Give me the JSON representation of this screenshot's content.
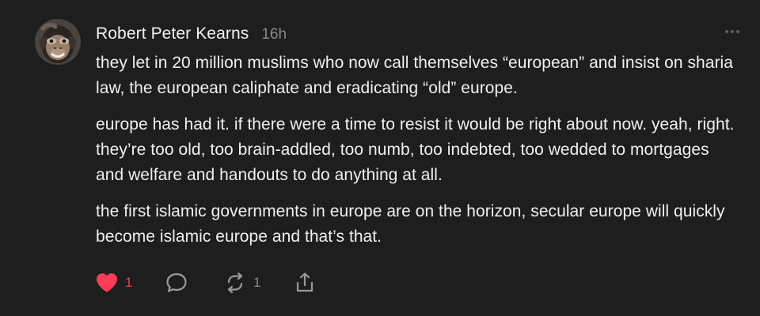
{
  "post": {
    "author": "Robert Peter Kearns",
    "time": "16h",
    "paragraphs": [
      "they let in 20 million muslims who now call themselves “european” and insist on sharia law, the european caliphate and eradicating “old” europe.",
      "europe has had it. if there were a time to resist it would be right about now. yeah, right. they’re too old, too brain-addled, too numb, too indebted, too wedded to mortgages and welfare and handouts to do anything at all.",
      "the first islamic governments in europe are on the horizon, secular europe will quickly become islamic europe and that’s that."
    ],
    "actions": {
      "like_count": "1",
      "repost_count": "1"
    }
  },
  "icons": {
    "more": "more-horizontal-icon",
    "like": "heart-icon",
    "reply": "comment-bubble-icon",
    "repost": "repost-icon",
    "share": "share-icon"
  },
  "colors": {
    "background": "#1e1e1e",
    "text": "#f0f0f0",
    "muted": "#8a8a8a",
    "like": "#ff3b55"
  }
}
